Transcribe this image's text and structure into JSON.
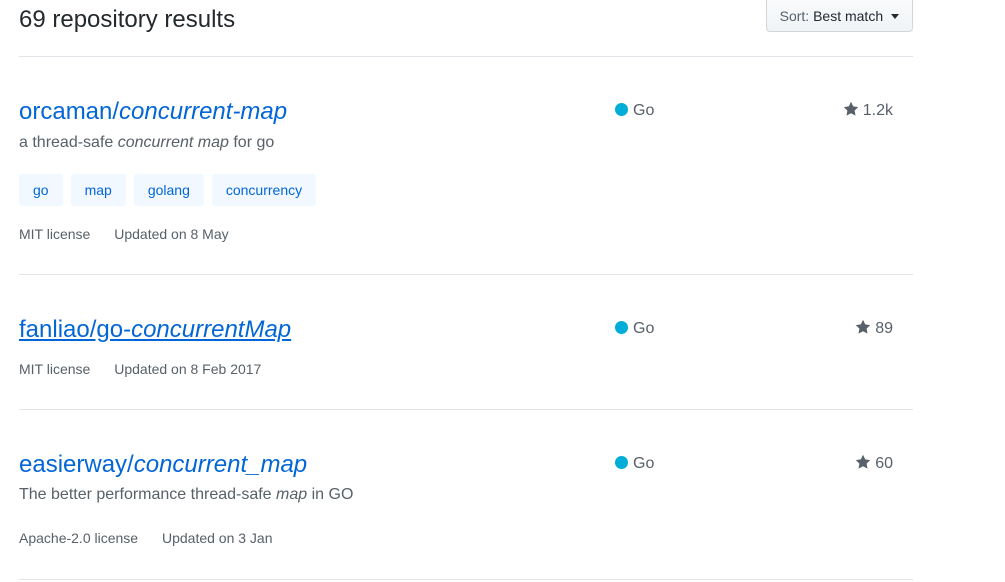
{
  "header": {
    "results_count": "69 repository results",
    "sort_prefix": "Sort:",
    "sort_value": "Best match"
  },
  "repos": [
    {
      "owner": "orcaman/",
      "name": "concurrent-map",
      "description_pre": "a thread-safe ",
      "description_em": "concurrent map",
      "description_post": " for go",
      "language": "Go",
      "stars": "1.2k",
      "topics": [
        "go",
        "map",
        "golang",
        "concurrency"
      ],
      "license": "MIT license",
      "updated": "Updated on 8 May"
    },
    {
      "owner": "fanliao/go-",
      "name": "concurrentMap",
      "language": "Go",
      "stars": "89",
      "license": "MIT license",
      "updated": "Updated on 8 Feb 2017"
    },
    {
      "owner": "easierway/",
      "name": "concurrent_map",
      "description_pre": "The better performance thread-safe ",
      "description_em": "map",
      "description_post": " in GO",
      "language": "Go",
      "stars": "60",
      "license": "Apache-2.0 license",
      "updated": "Updated on 3 Jan"
    }
  ],
  "colors": {
    "link": "#0366d6",
    "muted": "#586069",
    "go_language": "#00add8",
    "topic_bg": "#f1f8ff",
    "divider": "#e1e4e8"
  },
  "icons": {
    "star": "star-icon",
    "language_dot": "language-color-dot",
    "sort_caret": "caret-down-icon"
  }
}
